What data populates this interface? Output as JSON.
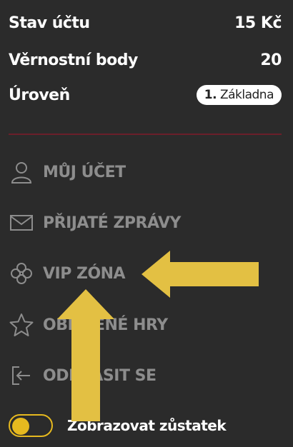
{
  "account": {
    "balance_label": "Stav účtu",
    "balance_value": "15 Kč",
    "points_label": "Věrnostní body",
    "points_value": "20",
    "level_label": "Úroveň",
    "level_number": "1.",
    "level_name": "Základna"
  },
  "menu": {
    "items": [
      {
        "label": "MŮJ ÚČET",
        "icon": "user-icon"
      },
      {
        "label": "PŘIJATÉ ZPRÁVY",
        "icon": "envelope-icon"
      },
      {
        "label": "VIP ZÓNA",
        "icon": "clover-icon"
      },
      {
        "label": "OBLÍBENÉ HRY",
        "icon": "star-icon"
      },
      {
        "label": "ODHLÁSIT SE",
        "icon": "logout-icon"
      }
    ]
  },
  "toggle": {
    "label": "Zobrazovat zůstatek",
    "state": "on"
  },
  "colors": {
    "background": "#2b2b2b",
    "menu_text": "#8d8d8d",
    "accent": "#e6b91f",
    "divider": "#6b1f2a",
    "arrow": "#e3c043"
  }
}
